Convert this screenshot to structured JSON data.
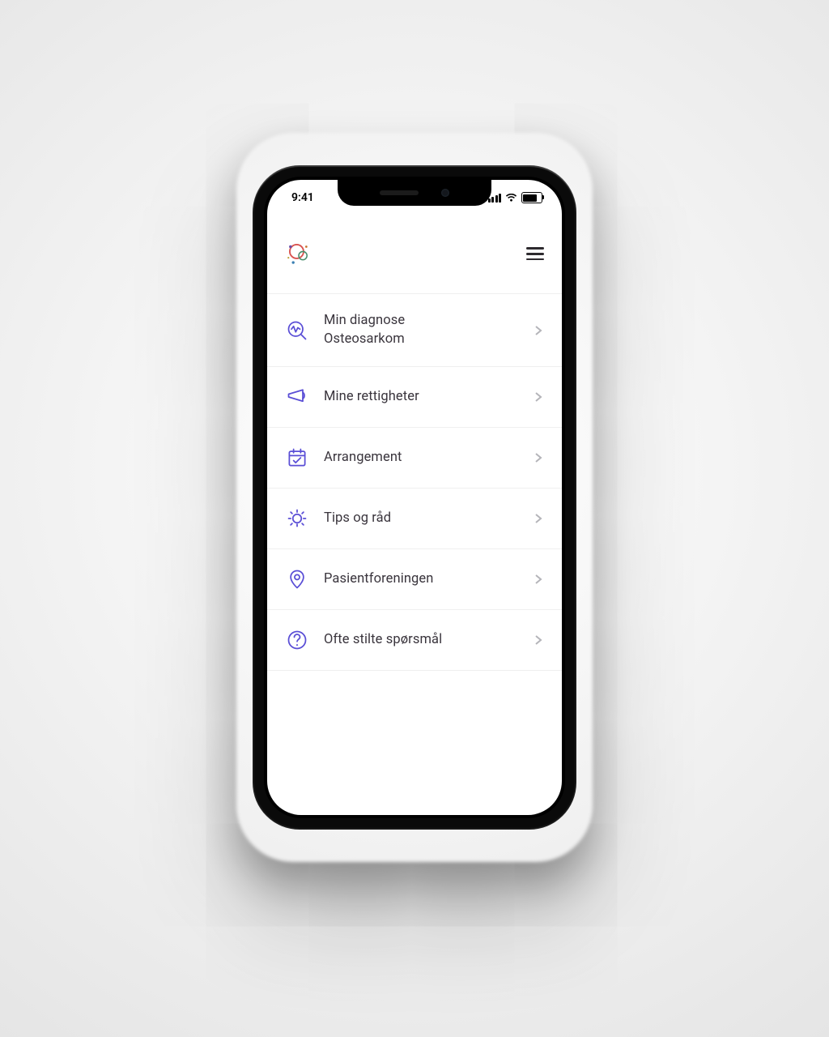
{
  "statusbar": {
    "time": "9:41"
  },
  "menu": {
    "items": [
      {
        "icon": "diagnosis-icon",
        "label": "Min diagnose\nOsteosarkom"
      },
      {
        "icon": "megaphone-icon",
        "label": "Mine rettigheter"
      },
      {
        "icon": "calendar-icon",
        "label": "Arrangement"
      },
      {
        "icon": "lightbulb-icon",
        "label": "Tips og råd"
      },
      {
        "icon": "location-icon",
        "label": "Pasientforeningen"
      },
      {
        "icon": "question-icon",
        "label": "Ofte stilte spørsmål"
      }
    ]
  },
  "colors": {
    "accent": "#5a4ed6"
  }
}
